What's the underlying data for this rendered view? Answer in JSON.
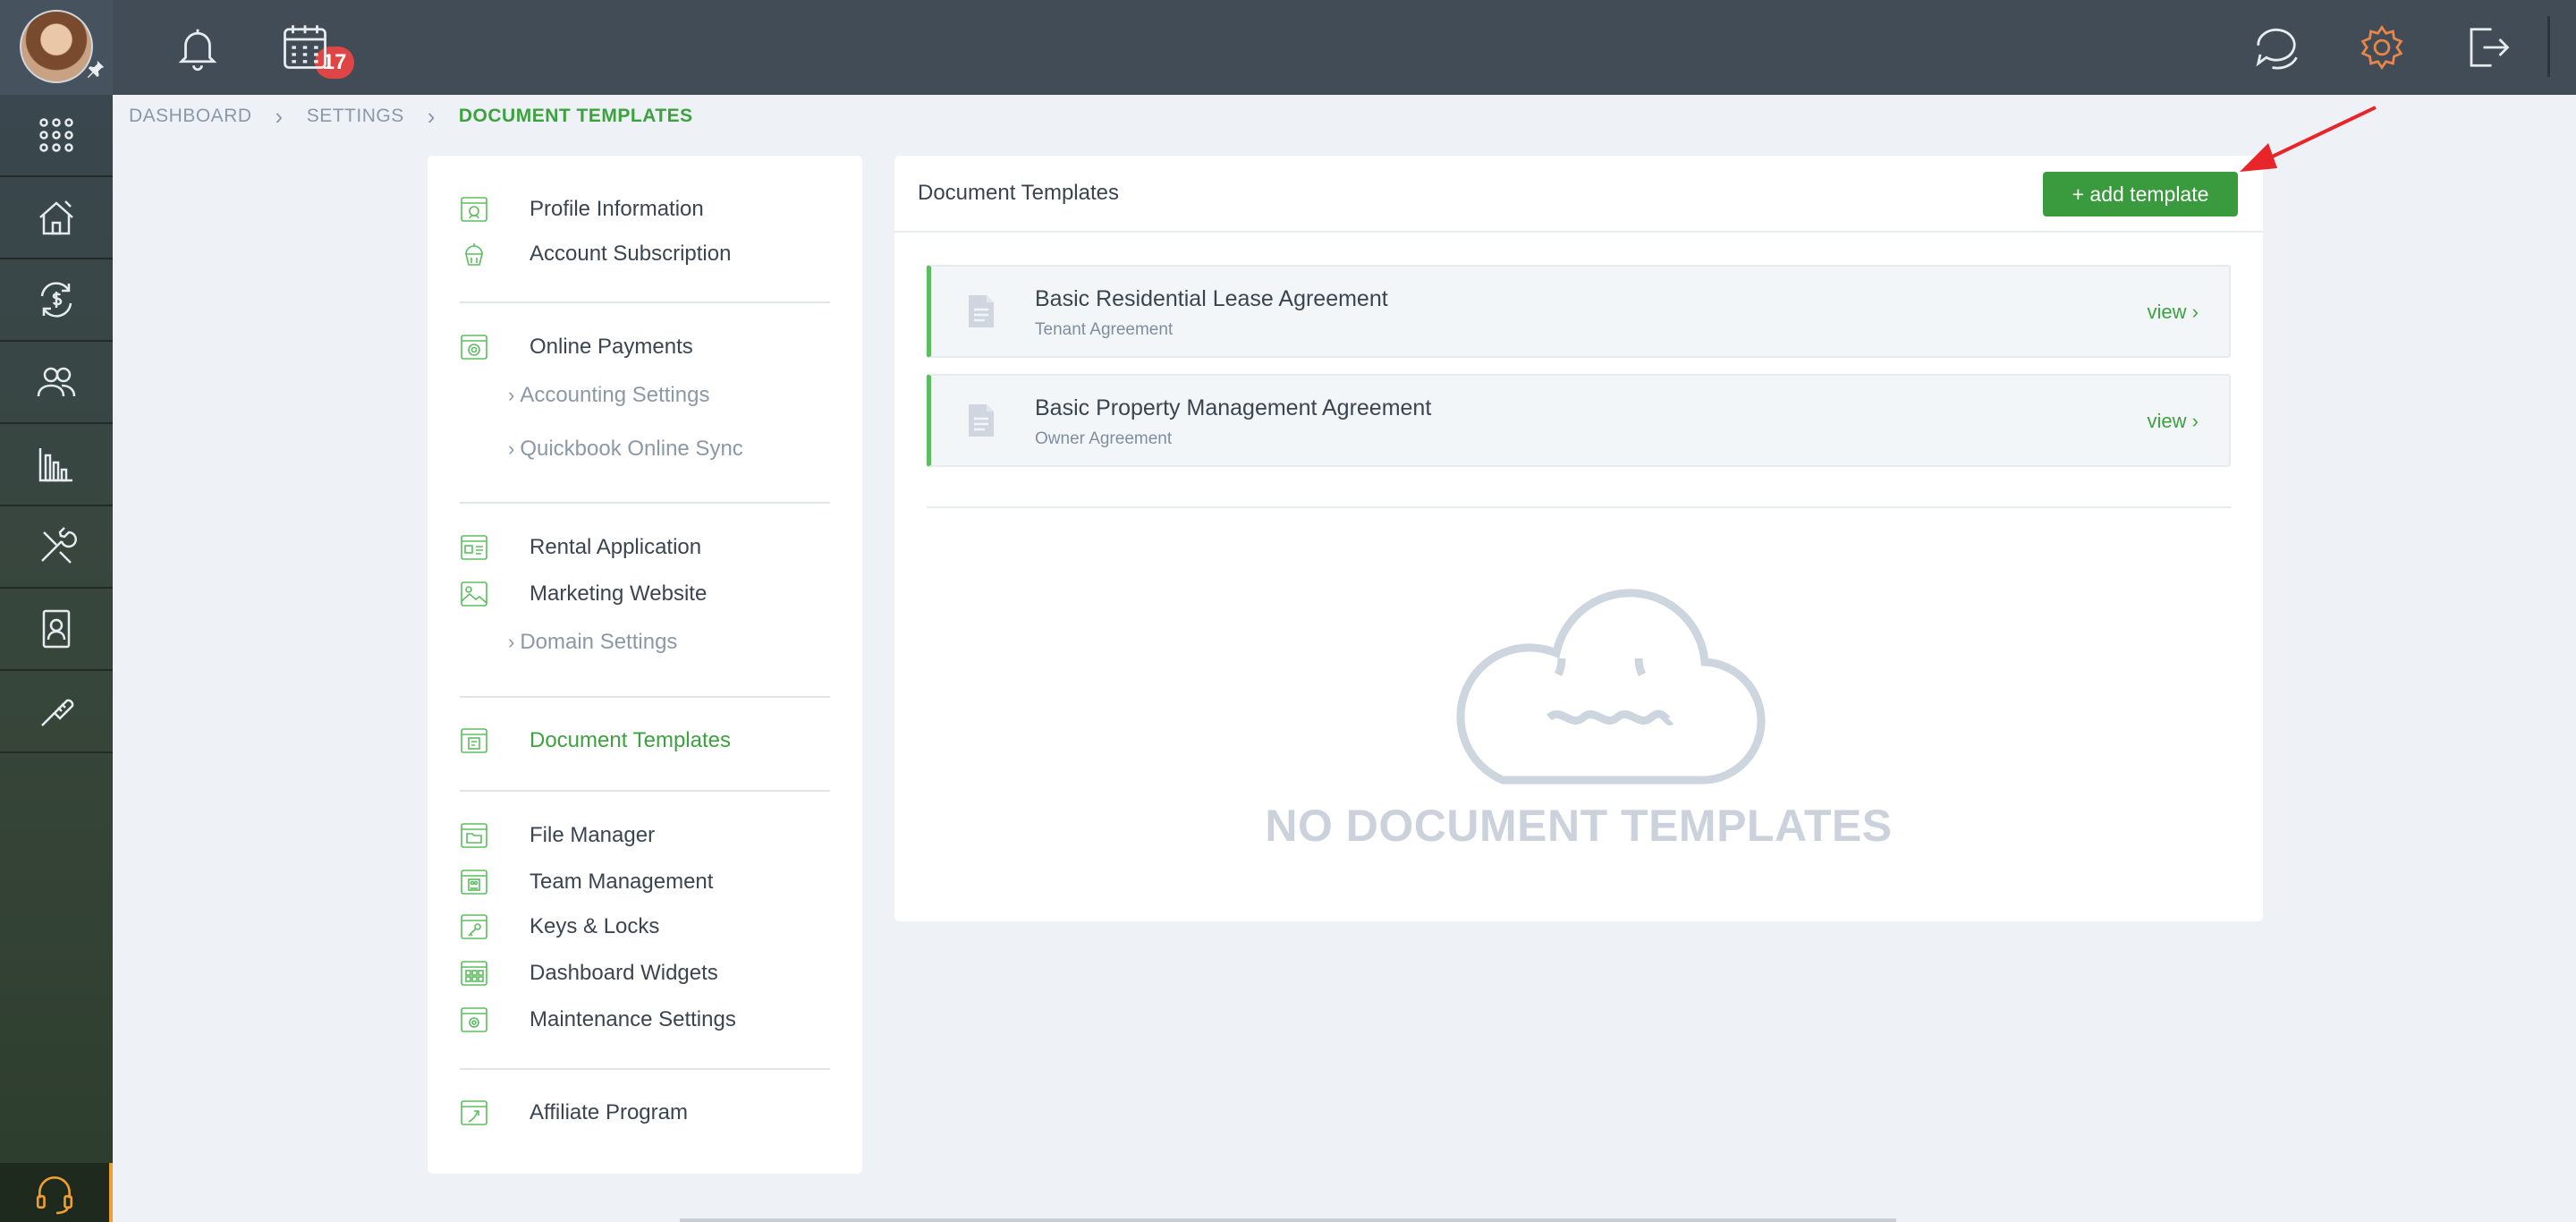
{
  "topbar": {
    "notifications_count": "17",
    "icons": [
      "bell-icon",
      "calendar-icon",
      "chat-icon",
      "gear-icon",
      "logout-icon"
    ]
  },
  "rail": {
    "items": [
      "apps-grid-icon",
      "property-icon",
      "payments-icon",
      "people-icon",
      "reports-icon",
      "maintenance-icon",
      "contacts-icon",
      "tools-icon"
    ],
    "support_icon": "headset-icon"
  },
  "breadcrumb": [
    "DASHBOARD",
    "SETTINGS",
    "DOCUMENT TEMPLATES"
  ],
  "menu": {
    "profile_information": "Profile Information",
    "account_subscription": "Account Subscription",
    "online_payments": "Online Payments",
    "accounting_settings": "Accounting Settings",
    "quickbook_online_sync": "Quickbook Online Sync",
    "rental_application": "Rental Application",
    "marketing_website": "Marketing Website",
    "domain_settings": "Domain Settings",
    "document_templates": "Document Templates",
    "file_manager": "File Manager",
    "team_management": "Team Management",
    "keys_locks": "Keys & Locks",
    "dashboard_widgets": "Dashboard Widgets",
    "maintenance_settings": "Maintenance Settings",
    "affiliate_program": "Affiliate Program"
  },
  "main": {
    "title": "Document Templates",
    "add_button": "+ add template",
    "templates": [
      {
        "name": "Basic Residential Lease Agreement",
        "type": "Tenant Agreement",
        "action": "view"
      },
      {
        "name": "Basic Property Management Agreement",
        "type": "Owner Agreement",
        "action": "view"
      }
    ],
    "empty_text": "NO DOCUMENT TEMPLATES"
  },
  "colors": {
    "accent_green": "#3da140",
    "button_green": "#3a9a3e",
    "badge_red": "#e04545",
    "gear_orange": "#e8854a",
    "annotation_red": "#e8262a"
  }
}
